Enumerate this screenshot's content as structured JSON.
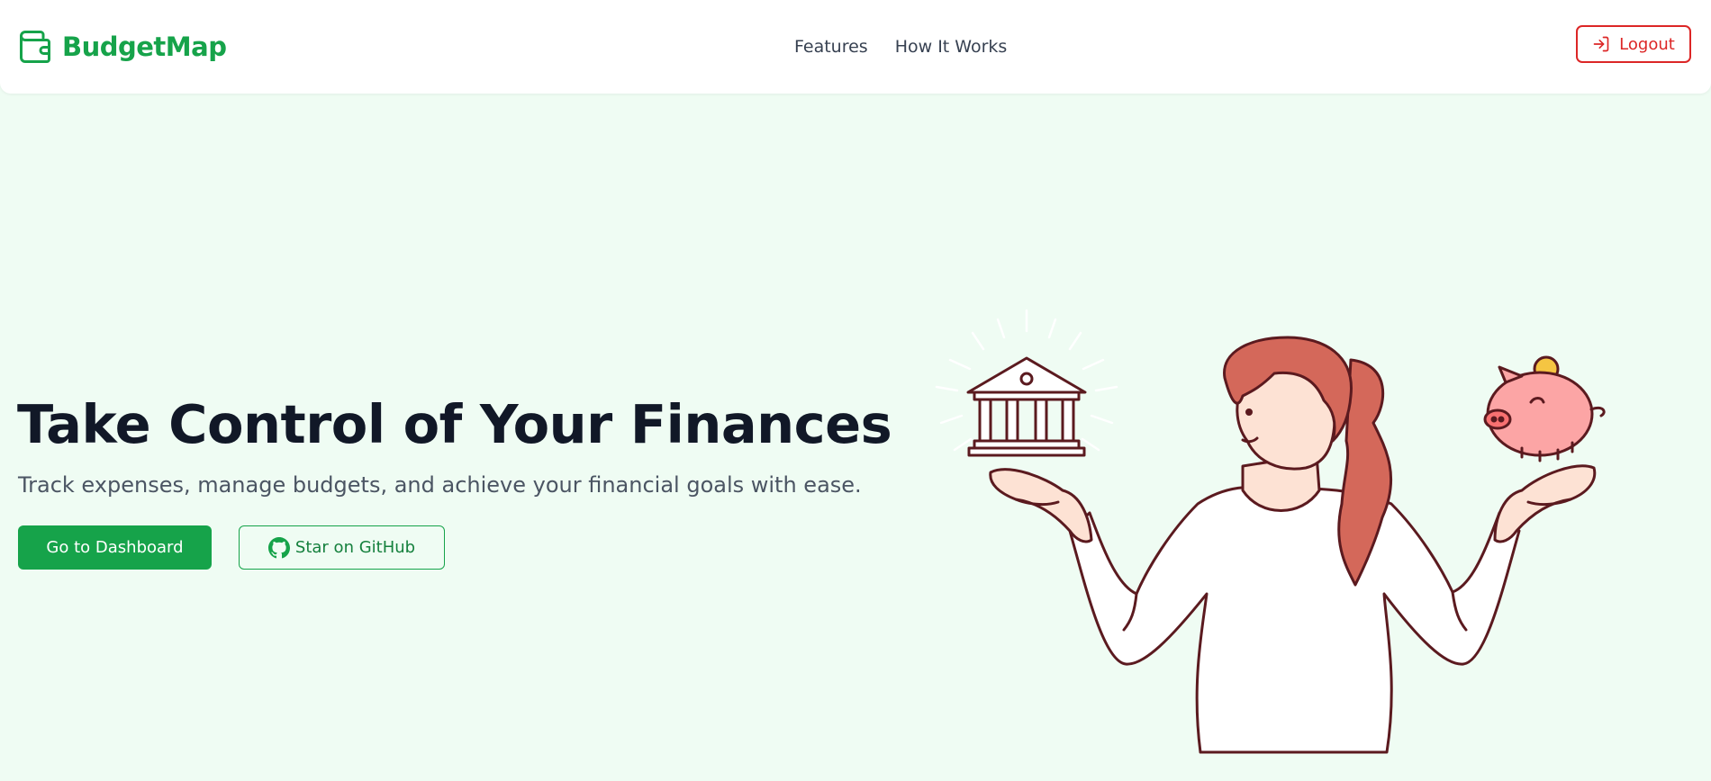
{
  "brand": {
    "name": "BudgetMap",
    "icon": "wallet-icon",
    "color": "#16a34a"
  },
  "nav": {
    "links": [
      {
        "label": "Features"
      },
      {
        "label": "How It Works"
      }
    ]
  },
  "auth": {
    "logout_label": "Logout",
    "logout_icon": "log-in-icon",
    "color": "#dc2626"
  },
  "hero": {
    "title": "Take Control of Your Finances",
    "subtitle": "Track expenses, manage budgets, and achieve your financial goals with ease.",
    "primary_cta": "Go to Dashboard",
    "secondary_cta": "Star on GitHub",
    "secondary_icon": "github-icon",
    "illustration": "woman-balancing-bank-and-piggy-bank"
  },
  "colors": {
    "accent": "#16a34a",
    "background": "#effcf3",
    "danger": "#dc2626",
    "heading": "#111827"
  }
}
